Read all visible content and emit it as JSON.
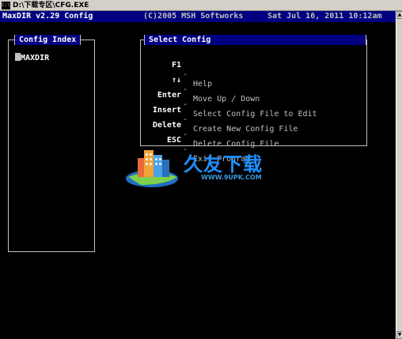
{
  "window": {
    "icon": "C:\\",
    "title": "D:\\下载专区\\CFG.EXE"
  },
  "header": {
    "app": "MaxDIR v2.29 Config",
    "copyright": "(C)2005 MSH Softworks",
    "datetime": "Sat Jul 16, 2011 10:12am"
  },
  "scrollbar": {
    "up": "▲",
    "down": "▼"
  },
  "index_panel": {
    "title": "Config Index",
    "items": [
      "MAXDIR"
    ]
  },
  "config_panel": {
    "title": "Select Config",
    "rows": [
      {
        "key": "F1",
        "dash": "-",
        "desc": "Help"
      },
      {
        "key": "↑↓",
        "dash": "-",
        "desc": "Move Up / Down"
      },
      {
        "key": "Enter",
        "dash": "-",
        "desc": "Select Config File to Edit"
      },
      {
        "key": "Insert",
        "dash": "-",
        "desc": "Create New Config File"
      },
      {
        "key": "Delete",
        "dash": "-",
        "desc": "Delete Config File"
      },
      {
        "key": "ESC",
        "dash": "-",
        "desc": "Exit Program"
      }
    ]
  },
  "watermark": {
    "text": "久友下载",
    "url": "WWW.9UPK.COM"
  },
  "colors": {
    "console_bg": "#000000",
    "header_bg": "#000080",
    "text": "#c0c0c0",
    "watermark": "#1e90ff"
  }
}
